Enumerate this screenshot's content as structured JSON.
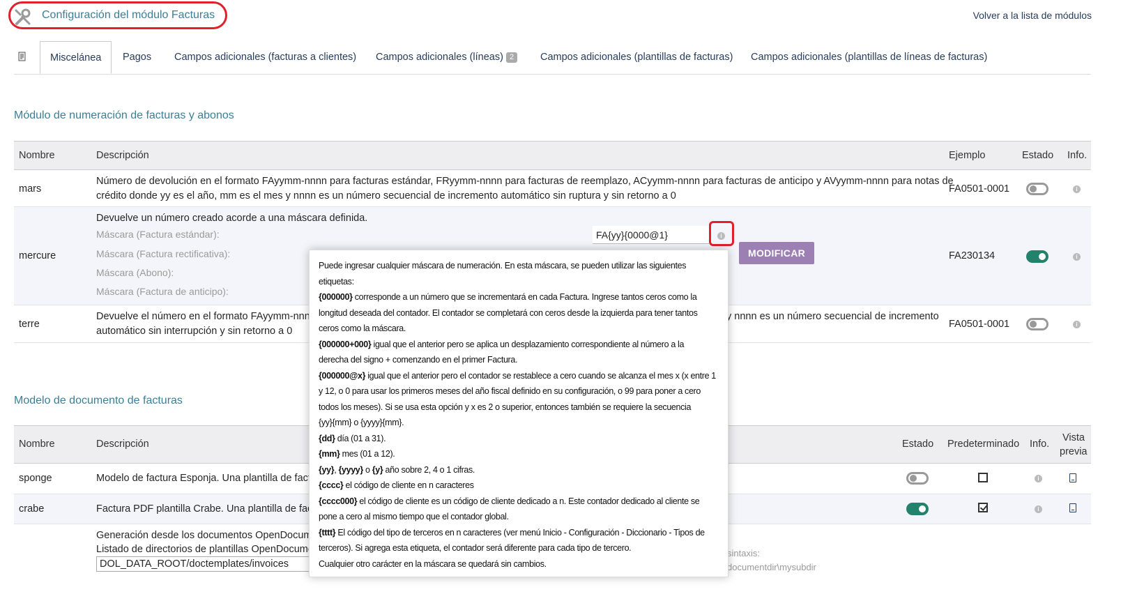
{
  "header": {
    "title": "Configuración del módulo Facturas",
    "back_link": "Volver a la lista de módulos",
    "icon": "tools-icon"
  },
  "tabs": [
    {
      "label": "Miscelánea",
      "active": true
    },
    {
      "label": "Pagos"
    },
    {
      "label": "Campos adicionales (facturas a clientes)"
    },
    {
      "label": "Campos adicionales (líneas)",
      "badge": "2"
    },
    {
      "label": "Campos adicionales (plantillas de facturas)"
    },
    {
      "label": "Campos adicionales (plantillas de líneas de facturas)"
    }
  ],
  "numbering": {
    "title": "Módulo de numeración de facturas y abonos",
    "columns": {
      "name": "Nombre",
      "description": "Descripción",
      "example": "Ejemplo",
      "status": "Estado",
      "info": "Info."
    },
    "rows": [
      {
        "name": "mars",
        "description_l1": "Número de devolución en el formato FAyymm-nnnn para facturas estándar, FRyymm-nnnn para facturas de reemplazo, ACyymm-nnnn para facturas de anticipo y AVyymm-nnnn para notas de",
        "description_l2": "crédito donde yy es el año, mm es el mes y nnnn es un número secuencial de incremento automático sin ruptura y sin retorno a 0",
        "example": "FA0501-0001",
        "enabled": false
      },
      {
        "name": "mercure",
        "description": "Devuelve un número creado acorde a una máscara definida.",
        "mask_labels": [
          "Máscara (Factura estándar):",
          "Máscara (Factura rectificativa):",
          "Máscara (Abono):",
          "Máscara (Factura de anticipo):"
        ],
        "mask_value": "FA{yy}{0000@1}",
        "button": "MODIFICAR",
        "example": "FA230134",
        "enabled": true
      },
      {
        "name": "terre",
        "description_l1": "Devuelve el número en el formato FAyymm-nnnn",
        "description_l1_end": "y nnnn es un número secuencial de incremento",
        "description_l2": "automático sin interrupción y sin retorno a 0",
        "example": "FA0501-0001",
        "enabled": false
      }
    ]
  },
  "models": {
    "title": "Modelo de documento de facturas",
    "columns": {
      "name": "Nombre",
      "description": "Descripción",
      "status": "Estado",
      "default": "Predeterminado",
      "info": "Info.",
      "preview_l1": "Vista",
      "preview_l2": "previa"
    },
    "rows": [
      {
        "name": "sponge",
        "description": "Modelo de factura Esponja. Una plantilla de factur",
        "enabled": false,
        "default": false
      },
      {
        "name": "crabe",
        "description": "Factura PDF plantilla Crabe. Una plantilla de factu",
        "enabled": true,
        "default": true
      }
    ],
    "odt_l1": "Generación desde los documentos OpenDocume",
    "odt_l2": "Listado de directorios de plantillas OpenDocumen",
    "odt_path": "DOL_DATA_ROOT/doctemplates/invoices",
    "odt_syntax": "sintaxis:",
    "odt_syntax_l2": "documentdir\\mysubdir"
  },
  "tooltip": {
    "intro_l1": "Puede ingresar cualquier máscara de numeración. En esta máscara, se pueden utilizar las siguientes",
    "intro_l2": "etiquetas:",
    "t1_tag": "{000000}",
    "t1_l1": " corresponde a un número que se incrementará en cada Factura. Ingrese tantos ceros como la",
    "t1_l2": "longitud deseada del contador. El contador se completará con ceros desde la izquierda para tener tantos",
    "t1_l3": "ceros como la máscara.",
    "t2_tag": "{000000+000}",
    "t2_l1": " igual que el anterior pero se aplica un desplazamiento correspondiente al número a la",
    "t2_l2": "derecha del signo + comenzando en el primer Factura.",
    "t3_tag": "{000000@x}",
    "t3_l1": " igual que el anterior pero el contador se restablece a cero cuando se alcanza el mes x (x entre 1",
    "t3_l2": "y 12, o 0 para usar los primeros meses del año fiscal definido en su configuración, o 99 para poner a cero",
    "t3_l3": "todos los meses). Si se usa esta opción y x es 2 o superior, entonces también se requiere la secuencia",
    "t3_l4": "{yy}{mm} o {yyyy}{mm}.",
    "t4_tag": "{dd}",
    "t4_text": " día (01 a 31).",
    "t5_tag": "{mm}",
    "t5_text": " mes (01 a 12).",
    "t6_tag_a": "{yy}",
    "t6_sep1": ", ",
    "t6_tag_b": "{yyyy}",
    "t6_sep2": " o ",
    "t6_tag_c": "{y}",
    "t6_text": " año sobre 2, 4 o 1 cifras.",
    "t7_tag": "{cccc}",
    "t7_text": " el código de cliente en n caracteres",
    "t8_tag": "{cccc000}",
    "t8_l1": " el código de cliente es un código de cliente dedicado a n. Este contador dedicado al cliente se",
    "t8_l2": "pone a cero al mismo tiempo que el contador global.",
    "t9_tag": "{tttt}",
    "t9_l1": " El código del tipo de terceros en n caracteres (ver menú Inicio - Configuración - Diccionario - Tipos de",
    "t9_l2": "terceros). Si agrega esta etiqueta, el contador será diferente para cada tipo de tercero.",
    "t10": "Cualquier otro carácter en la máscara se quedará sin cambios."
  },
  "colors": {
    "accent": "#3a7f96",
    "link": "#263c5c",
    "toggle_on": "#22826c",
    "button": "#9c7fb3",
    "highlight": "#e0202a"
  }
}
